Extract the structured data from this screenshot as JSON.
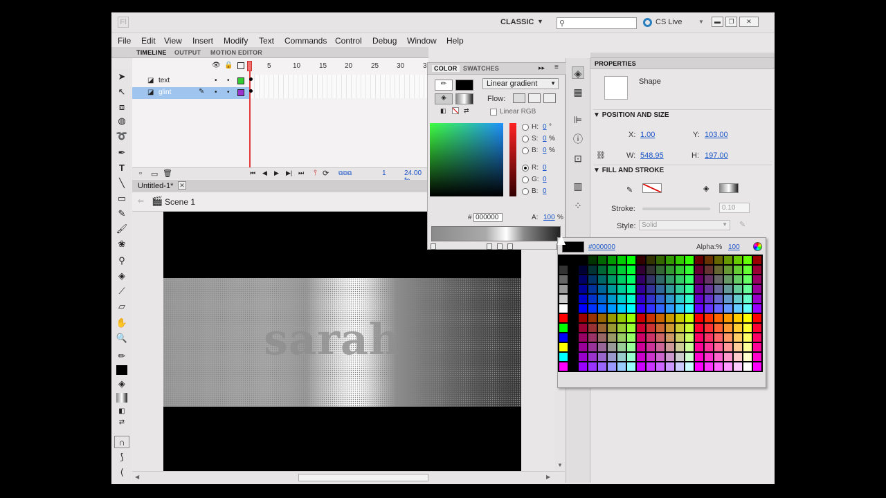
{
  "titlebar": {
    "logo": "Fl",
    "workspace": "CLASSIC",
    "search_placeholder": "",
    "cslive": "CS Live"
  },
  "menu": [
    "File",
    "Edit",
    "View",
    "Insert",
    "Modify",
    "Text",
    "Commands",
    "Control",
    "Debug",
    "Window",
    "Help"
  ],
  "timeline": {
    "tabs": [
      "TIMELINE",
      "OUTPUT",
      "MOTION EDITOR"
    ],
    "layers": [
      {
        "name": "text",
        "color": "#33cc33"
      },
      {
        "name": "glint",
        "color": "#9933cc"
      }
    ],
    "frame_numbers": [
      "1",
      "5",
      "10",
      "15",
      "20",
      "25",
      "30",
      "3"
    ],
    "current_frame": "1",
    "fps": "24.00 fp"
  },
  "document": {
    "title": "Untitled-1*",
    "scene": "Scene 1",
    "stage_text": "sarah"
  },
  "color_panel": {
    "tabs": [
      "COLOR",
      "SWATCHES"
    ],
    "fill_type": "Linear gradient",
    "flow_label": "Flow:",
    "linear_rgb_label": "Linear RGB",
    "h_label": "H:",
    "h_value": "0",
    "h_unit": "°",
    "s_label": "S:",
    "s_value": "0",
    "s_unit": "%",
    "b_label": "B:",
    "b_value": "0",
    "b_unit": "%",
    "r_label": "R:",
    "r_value": "0",
    "g_label": "G:",
    "g_value": "0",
    "bl_label": "B:",
    "bl_value": "0",
    "hex_label": "#",
    "hex_value": "000000",
    "a_label": "A:",
    "a_value": "100",
    "a_unit": "%"
  },
  "properties": {
    "tab": "PROPERTIES",
    "object_type": "Shape",
    "position_section": "POSITION AND SIZE",
    "x_label": "X:",
    "x_value": "1.00",
    "y_label": "Y:",
    "y_value": "103.00",
    "w_label": "W:",
    "w_value": "548.95",
    "h_label": "H:",
    "h_value": "197.00",
    "fill_section": "FILL AND STROKE",
    "stroke_label": "Stroke:",
    "stroke_value": "0.10",
    "style_label": "Style:",
    "style_value": "Solid"
  },
  "swatch_popup": {
    "hex": "#000000",
    "alpha_label": "Alpha:%",
    "alpha_value": "100"
  },
  "colors": {
    "accent": "#1a55c9",
    "layer_selected": "#9fc5ee",
    "playhead": "#e13a3a"
  }
}
